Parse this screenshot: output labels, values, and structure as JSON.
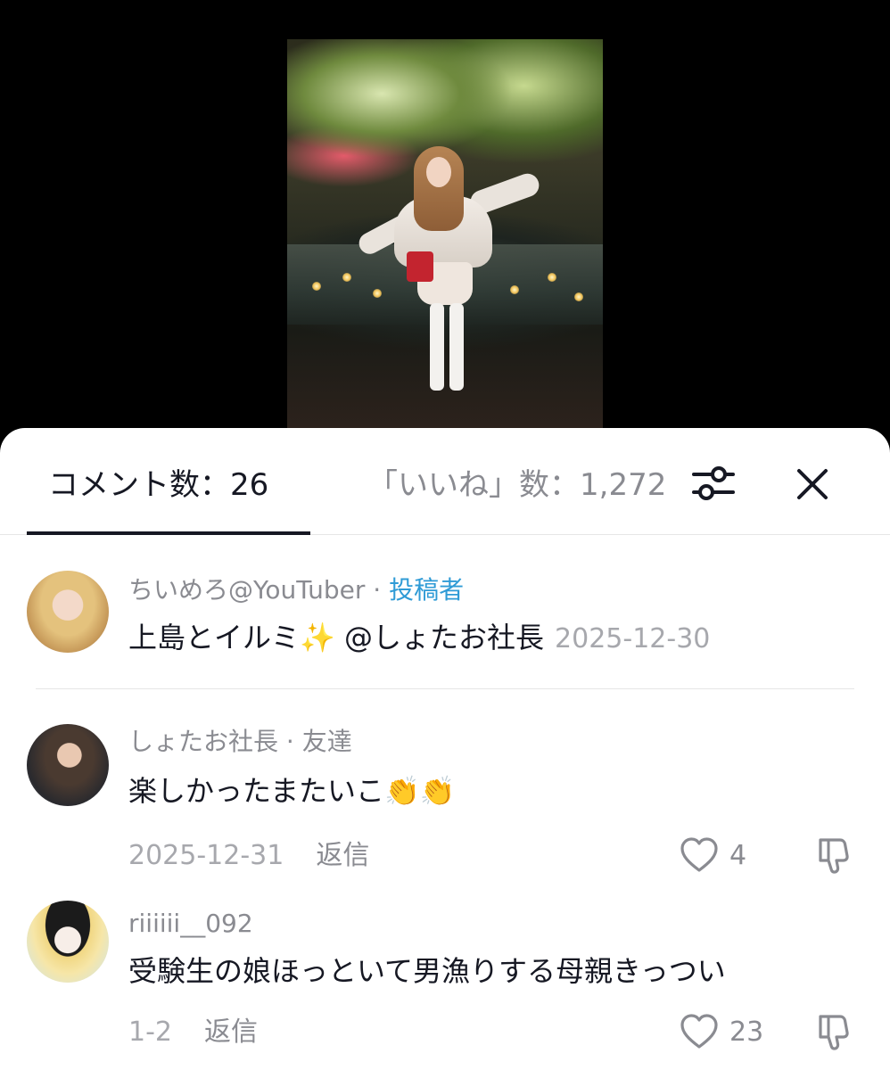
{
  "tabs": {
    "comments_label": "コメント数：26",
    "likes_label": "「いいね」数：1,272"
  },
  "icons": {
    "filter": "sliders-icon",
    "close": "close-icon",
    "like": "heart-icon",
    "dislike": "thumbs-down-icon"
  },
  "comments": [
    {
      "username": "ちいめろ@YouTuber",
      "separator": " · ",
      "tag": "投稿者",
      "text": "上島とイルミ✨ @しょたお社長",
      "date": "2025-12-30"
    },
    {
      "username": "しょたお社長 · 友達",
      "text": "楽しかったまたいこ👏👏",
      "date": "2025-12-31",
      "reply_label": "返信",
      "likes": "4"
    },
    {
      "username": "riiiiii__092",
      "text": "受験生の娘ほっといて男漁りする母親きっつい",
      "date": "1-2",
      "reply_label": "返信",
      "likes": "23"
    }
  ],
  "colors": {
    "text_primary": "#161823",
    "text_secondary": "#8a8b91",
    "author_tag": "#2f9bd6",
    "divider": "#e6e6e6"
  }
}
